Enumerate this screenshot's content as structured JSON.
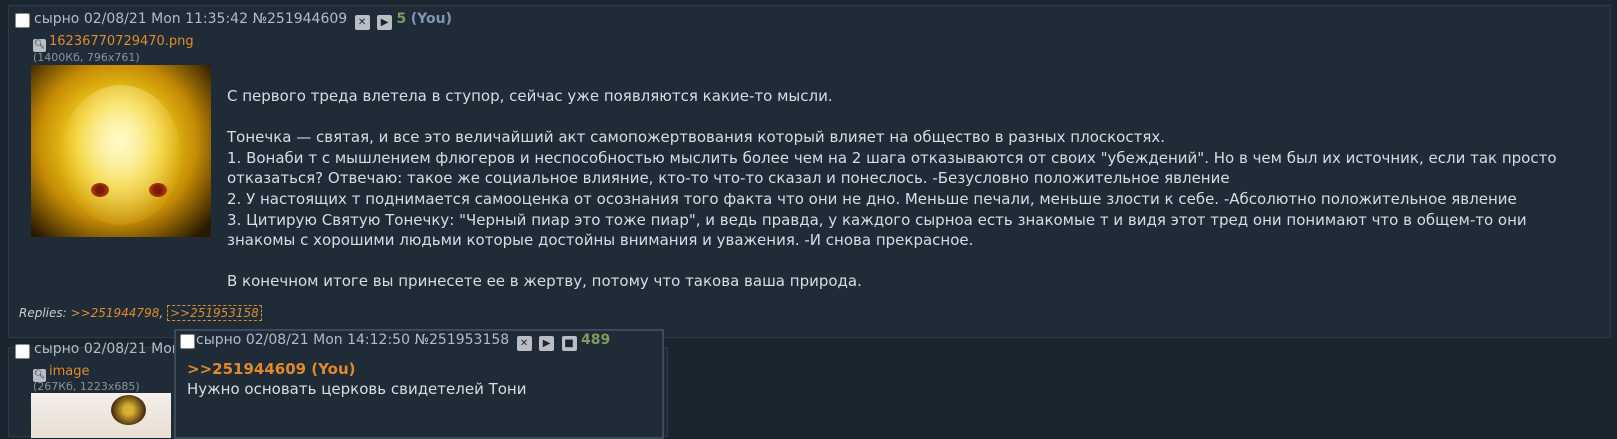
{
  "post_main": {
    "name": "сырно",
    "datetime": "02/08/21 Mon 11:35:42",
    "number": "№251944609",
    "you_count": "5",
    "you_label": "(You)",
    "file": {
      "name": "16236770729470.png",
      "info": "(1400Кб, 796x761)"
    },
    "paragraphs": [
      "С первого треда влетела в ступор, сейчас уже появляются какие-то мысли.",
      "Тонечка — святая, и все это величайший акт самопожертвования который влияет на общество в разных плоскостях.\n1. Вонаби т с мышлением флюгеров и неспособностью мыслить более чем на 2 шага отказываются от своих \"убеждений\". Но в чем был их источник, если так просто отказаться? Отвечаю: такое же социальное влияние, кто-то что-то сказал и понеслось. -Безусловно положительное явление\n2. У настоящих т поднимается самооценка от осознания того факта что они не дно. Меньше печали, меньше злости к себе. -Абсолютно положительное явление\n3. Цитирую Святую Тонечку: \"Черный пиар это тоже пиар\", и ведь правда, у каждого сырноа есть знакомые т и видя этот тред они понимают что в общем-то они знакомы с хорошими людьми которые достойны внимания и уважения. -И снова прекрасное.",
      "В конечном итоге вы принесете ее в жертву, потому что такова ваша природа."
    ],
    "replies_label": "Replies:",
    "replies": [
      ">>251944798",
      ">>251953158"
    ]
  },
  "post_second": {
    "name": "сырно",
    "datetime": "02/08/21 Mon",
    "file": {
      "name": "image",
      "info": "(267Кб, 1223x685)"
    }
  },
  "post_popup": {
    "name": "сырно",
    "datetime": "02/08/21 Mon 14:12:50",
    "number": "№251953158",
    "post_count": "489",
    "quote": ">>251944609 (You)",
    "text": "Нужно основать церковь свидетелей Тони"
  },
  "icons": {
    "hide": "close-icon",
    "play": "play-icon",
    "stop": "stop-icon",
    "expand": "magnify-icon"
  },
  "colors": {
    "background": "#1b2530",
    "post_background": "#1f2b37",
    "link": "#e08a2c",
    "you": "#8096b3",
    "count": "#7e9c5a"
  }
}
